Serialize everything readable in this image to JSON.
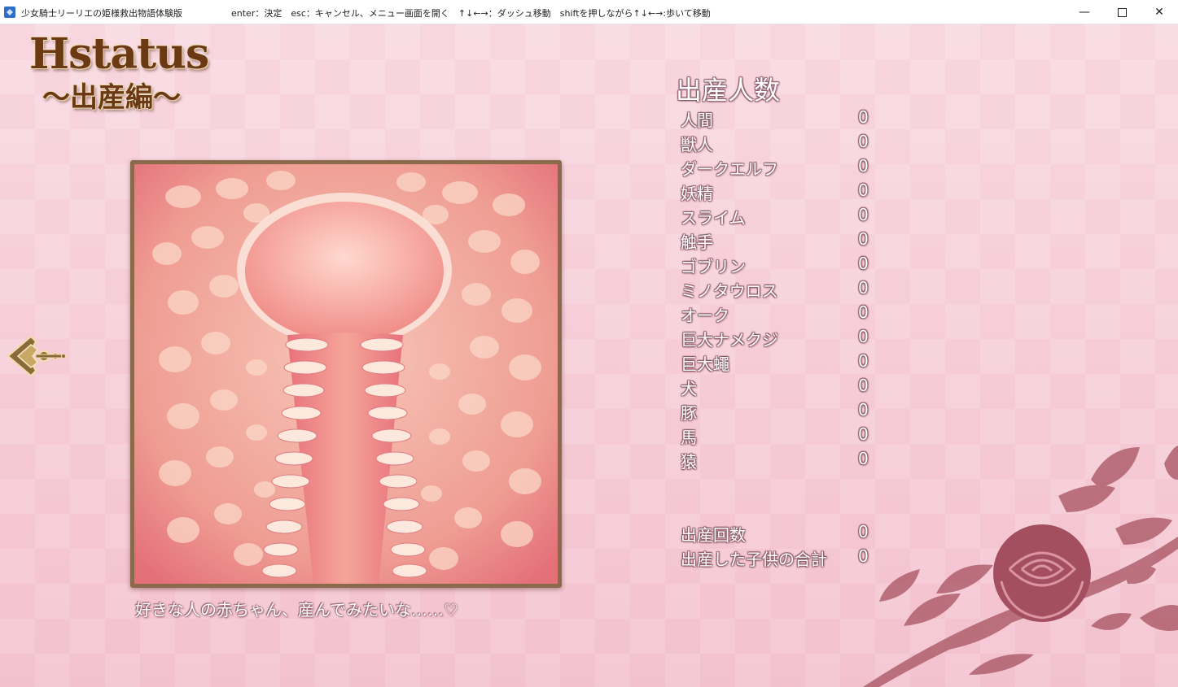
{
  "window": {
    "title": "少女騎士リーリエの姫様救出物語体験版",
    "hints": "enter：決定　esc：キャンセル、メニュー画面を開く　↑↓←→：ダッシュ移動　shiftを押しながら↑↓←→:歩いて移動",
    "minimize_glyph": "—",
    "close_glyph": "✕"
  },
  "logo": {
    "main": "Hstatus",
    "sub": "～出産編～"
  },
  "caption": "好きな人の赤ちゃん、産んでみたいな……♡",
  "stats": {
    "heading": "出産人数",
    "rows": [
      {
        "label": "人間",
        "value": "0"
      },
      {
        "label": "獣人",
        "value": "0"
      },
      {
        "label": "ダークエルフ",
        "value": "0"
      },
      {
        "label": "妖精",
        "value": "0"
      },
      {
        "label": "スライム",
        "value": "0"
      },
      {
        "label": "触手",
        "value": "0"
      },
      {
        "label": "ゴブリン",
        "value": "0"
      },
      {
        "label": "ミノタウロス",
        "value": "0"
      },
      {
        "label": "オーク",
        "value": "0"
      },
      {
        "label": "巨大ナメクジ",
        "value": "0"
      },
      {
        "label": "巨大蠅",
        "value": "0"
      },
      {
        "label": "犬",
        "value": "0"
      },
      {
        "label": "豚",
        "value": "0"
      },
      {
        "label": "馬",
        "value": "0"
      },
      {
        "label": "猿",
        "value": "0"
      }
    ],
    "totals": [
      {
        "label": "出産回数",
        "value": "0"
      },
      {
        "label": "出産した子供の合計",
        "value": "0"
      }
    ]
  },
  "icons": {
    "back": "ornate-back-arrow-icon",
    "app": "app-icon"
  },
  "colors": {
    "background": "#f4c9d4",
    "text": "#ffffff",
    "text_outline": "#8c5a68",
    "logo": "#6b3a14",
    "rose": "#b0606e",
    "frame": "#8a6a4a"
  }
}
